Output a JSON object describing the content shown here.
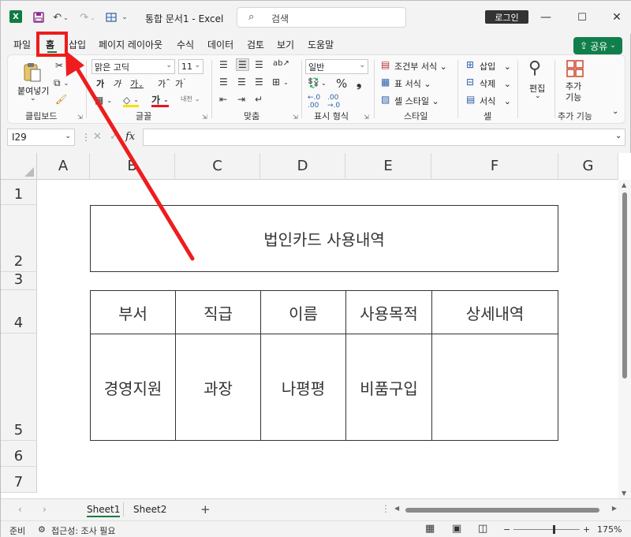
{
  "titlebar": {
    "doc_title": "통합 문서1  -  Excel",
    "search_placeholder": "검색",
    "login_label": "로그인"
  },
  "menu": {
    "tabs": [
      "파일",
      "홈",
      "삽입",
      "페이지 레이아웃",
      "수식",
      "데이터",
      "검토",
      "보기",
      "도움말"
    ],
    "share_label": "공유"
  },
  "ribbon": {
    "clipboard": {
      "paste_label": "붙여넣기",
      "group_label": "클립보드"
    },
    "font": {
      "font_name": "맑은 고딕",
      "font_size": "11",
      "group_label": "글꼴"
    },
    "alignment": {
      "group_label": "맞춤"
    },
    "number": {
      "format": "일반",
      "group_label": "표시 형식"
    },
    "styles": {
      "conditional": "조건부 서식",
      "table": "표 서식",
      "cell_style": "셀 스타일",
      "group_label": "스타일"
    },
    "cells": {
      "insert": "삽입",
      "delete": "삭제",
      "format": "서식",
      "group_label": "셀"
    },
    "editing": {
      "label": "편집"
    },
    "addins": {
      "label": "추가\n기능",
      "group_label": "추가 기능"
    }
  },
  "formula": {
    "name_box": "I29",
    "fx": "fx"
  },
  "grid": {
    "columns": [
      "A",
      "B",
      "C",
      "D",
      "E",
      "F",
      "G"
    ],
    "rows": [
      "1",
      "2",
      "3",
      "4",
      "5",
      "6",
      "7"
    ],
    "title": "법인카드 사용내역",
    "headers": [
      "부서",
      "직급",
      "이름",
      "사용목적",
      "상세내역"
    ],
    "values": [
      "경영지원",
      "과장",
      "나평평",
      "비품구입",
      ""
    ]
  },
  "sheets": {
    "tabs": [
      "Sheet1",
      "Sheet2"
    ],
    "active": "Sheet1"
  },
  "status": {
    "ready": "준비",
    "accessibility": "접근성: 조사 필요",
    "zoom": "175%"
  },
  "annotation": {
    "color": "#ee1c1c"
  }
}
